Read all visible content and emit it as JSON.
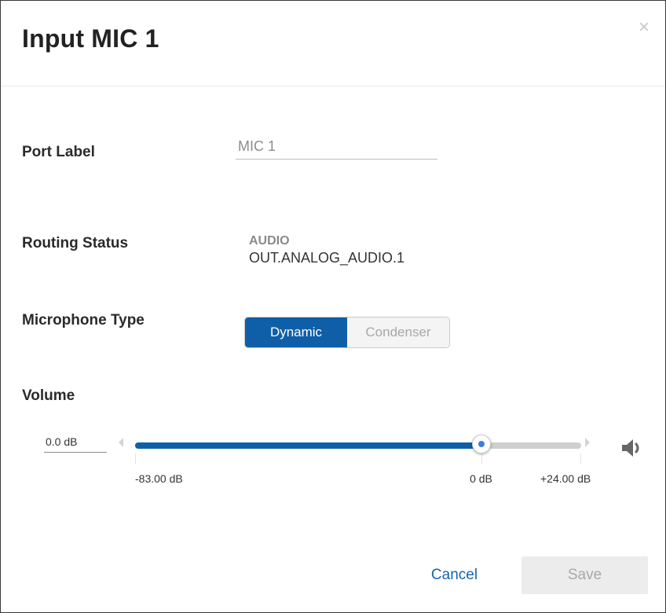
{
  "dialog": {
    "title": "Input MIC 1",
    "close_glyph": "×"
  },
  "port_label": {
    "label": "Port Label",
    "value": "MIC 1"
  },
  "routing_status": {
    "label": "Routing Status",
    "type": "AUDIO",
    "destination": "OUT.ANALOG_AUDIO.1"
  },
  "microphone_type": {
    "label": "Microphone Type",
    "options": [
      "Dynamic",
      "Condenser"
    ],
    "selected": "Dynamic"
  },
  "volume": {
    "label": "Volume",
    "value_text": "0.0 dB",
    "min_db": -83,
    "max_db": 24,
    "current_db": 0,
    "min_label": "-83.00 dB",
    "zero_label": "0 dB",
    "max_label": "+24.00 dB",
    "mute_icon": "speaker-icon"
  },
  "footer": {
    "cancel_label": "Cancel",
    "save_label": "Save"
  },
  "colors": {
    "accent": "#0f5fa8",
    "link": "#1764b0",
    "disabled_bg": "#ececec",
    "disabled_text": "#a9a9a9"
  }
}
